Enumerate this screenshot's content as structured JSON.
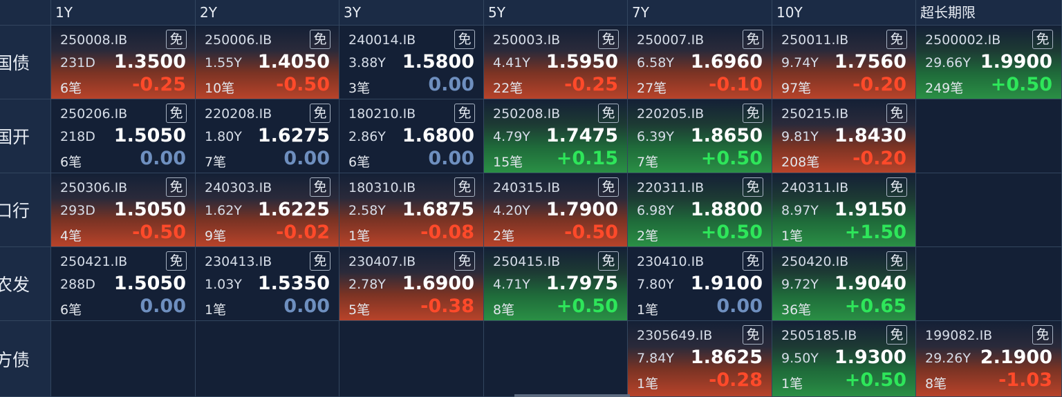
{
  "columns": [
    "1Y",
    "2Y",
    "3Y",
    "5Y",
    "7Y",
    "10Y",
    "超长期限"
  ],
  "rows": [
    {
      "label": "国债",
      "cells": [
        {
          "code": "250008.IB",
          "tag": "免",
          "term": "231D",
          "yield": "1.3500",
          "count": "6笔",
          "change": "-0.25",
          "trend": "down"
        },
        {
          "code": "250006.IB",
          "tag": "免",
          "term": "1.55Y",
          "yield": "1.4050",
          "count": "10笔",
          "change": "-0.50",
          "trend": "down"
        },
        {
          "code": "240014.IB",
          "tag": "免",
          "term": "3.88Y",
          "yield": "1.5800",
          "count": "3笔",
          "change": "0.00",
          "trend": "flat"
        },
        {
          "code": "250003.IB",
          "tag": "免",
          "term": "4.41Y",
          "yield": "1.5950",
          "count": "22笔",
          "change": "-0.25",
          "trend": "down"
        },
        {
          "code": "250007.IB",
          "tag": "免",
          "term": "6.58Y",
          "yield": "1.6960",
          "count": "27笔",
          "change": "-0.10",
          "trend": "down"
        },
        {
          "code": "250011.IB",
          "tag": "免",
          "term": "9.74Y",
          "yield": "1.7560",
          "count": "97笔",
          "change": "-0.20",
          "trend": "down"
        },
        {
          "code": "2500002.IB",
          "tag": "免",
          "term": "29.66Y",
          "yield": "1.9900",
          "count": "249笔",
          "change": "+0.50",
          "trend": "up"
        }
      ]
    },
    {
      "label": "国开",
      "cells": [
        {
          "code": "250206.IB",
          "tag": "免",
          "term": "218D",
          "yield": "1.5050",
          "count": "6笔",
          "change": "0.00",
          "trend": "flat"
        },
        {
          "code": "220208.IB",
          "tag": "免",
          "term": "1.80Y",
          "yield": "1.6275",
          "count": "7笔",
          "change": "0.00",
          "trend": "flat"
        },
        {
          "code": "180210.IB",
          "tag": "免",
          "term": "2.86Y",
          "yield": "1.6800",
          "count": "6笔",
          "change": "0.00",
          "trend": "flat"
        },
        {
          "code": "250208.IB",
          "tag": "免",
          "term": "4.79Y",
          "yield": "1.7475",
          "count": "15笔",
          "change": "+0.15",
          "trend": "up"
        },
        {
          "code": "220205.IB",
          "tag": "免",
          "term": "6.39Y",
          "yield": "1.8650",
          "count": "7笔",
          "change": "+0.50",
          "trend": "up"
        },
        {
          "code": "250215.IB",
          "tag": "免",
          "term": "9.81Y",
          "yield": "1.8430",
          "count": "208笔",
          "change": "-0.20",
          "trend": "down"
        },
        null
      ]
    },
    {
      "label": "口行",
      "cells": [
        {
          "code": "250306.IB",
          "tag": "免",
          "term": "293D",
          "yield": "1.5050",
          "count": "4笔",
          "change": "-0.50",
          "trend": "down"
        },
        {
          "code": "240303.IB",
          "tag": "免",
          "term": "1.62Y",
          "yield": "1.6225",
          "count": "9笔",
          "change": "-0.02",
          "trend": "down"
        },
        {
          "code": "180310.IB",
          "tag": "免",
          "term": "2.58Y",
          "yield": "1.6875",
          "count": "1笔",
          "change": "-0.08",
          "trend": "down"
        },
        {
          "code": "240315.IB",
          "tag": "免",
          "term": "4.20Y",
          "yield": "1.7900",
          "count": "2笔",
          "change": "-0.50",
          "trend": "down"
        },
        {
          "code": "220311.IB",
          "tag": "免",
          "term": "6.98Y",
          "yield": "1.8800",
          "count": "2笔",
          "change": "+0.50",
          "trend": "up"
        },
        {
          "code": "240311.IB",
          "tag": "免",
          "term": "8.97Y",
          "yield": "1.9150",
          "count": "1笔",
          "change": "+1.50",
          "trend": "up"
        },
        null
      ]
    },
    {
      "label": "农发",
      "cells": [
        {
          "code": "250421.IB",
          "tag": "免",
          "term": "288D",
          "yield": "1.5050",
          "count": "6笔",
          "change": "0.00",
          "trend": "flat"
        },
        {
          "code": "230413.IB",
          "tag": "免",
          "term": "1.03Y",
          "yield": "1.5350",
          "count": "1笔",
          "change": "0.00",
          "trend": "flat"
        },
        {
          "code": "230407.IB",
          "tag": "免",
          "term": "2.78Y",
          "yield": "1.6900",
          "count": "5笔",
          "change": "-0.38",
          "trend": "down"
        },
        {
          "code": "250415.IB",
          "tag": "免",
          "term": "4.71Y",
          "yield": "1.7975",
          "count": "8笔",
          "change": "+0.50",
          "trend": "up"
        },
        {
          "code": "230410.IB",
          "tag": "免",
          "term": "7.80Y",
          "yield": "1.9100",
          "count": "1笔",
          "change": "0.00",
          "trend": "flat"
        },
        {
          "code": "250420.IB",
          "tag": "免",
          "term": "9.72Y",
          "yield": "1.9040",
          "count": "36笔",
          "change": "+0.65",
          "trend": "up"
        },
        null
      ]
    },
    {
      "label": "地方债",
      "cells": [
        null,
        null,
        null,
        null,
        {
          "code": "2305649.IB",
          "tag": "免",
          "term": "7.84Y",
          "yield": "1.8625",
          "count": "1笔",
          "change": "-0.28",
          "trend": "down"
        },
        {
          "code": "2505185.IB",
          "tag": "免",
          "term": "9.50Y",
          "yield": "1.9300",
          "count": "1笔",
          "change": "+0.50",
          "trend": "up"
        },
        {
          "code": "199082.IB",
          "tag": "免",
          "term": "29.26Y",
          "yield": "2.1900",
          "count": "8笔",
          "change": "-1.03",
          "trend": "down"
        }
      ]
    }
  ],
  "colors": {
    "background": "#142036",
    "header_bg": "#1b2b45",
    "down": "#ff4a2a",
    "up": "#2ee65a",
    "flat": "#6e8fbf"
  }
}
